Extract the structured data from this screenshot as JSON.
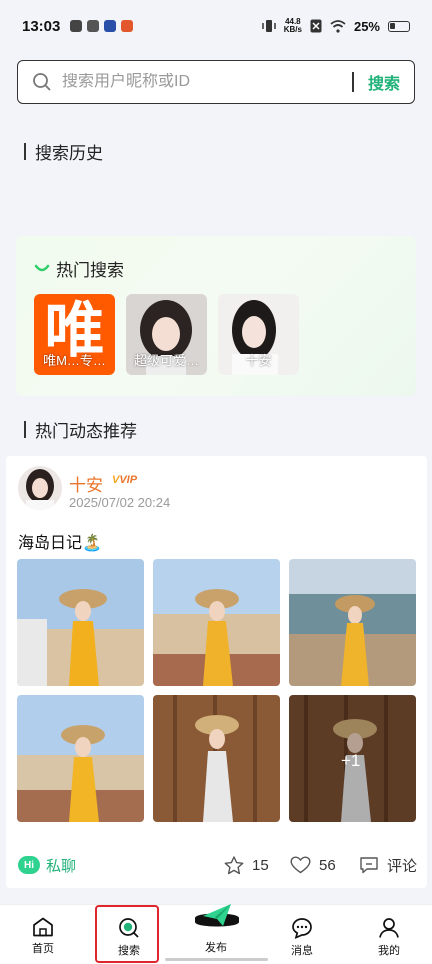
{
  "status_bar": {
    "time": "13:03",
    "net_speed_value": "44.8",
    "net_speed_unit": "KB/s",
    "battery": "25%"
  },
  "search": {
    "placeholder": "搜索用户昵称或ID",
    "button": "搜索"
  },
  "history": {
    "title": "搜索历史"
  },
  "hot_search": {
    "title": "热门搜索",
    "items": [
      {
        "label": "唯M…专…",
        "logo_text": "唯"
      },
      {
        "label": "超级可爱…"
      },
      {
        "label": "十安"
      }
    ]
  },
  "recommend": {
    "title": "热门动态推荐"
  },
  "post": {
    "username": "十安",
    "vip": "VIP",
    "time": "2025/07/02 20:24",
    "text": "海岛日记🏝️",
    "more_photos": "+1",
    "chat_badge": "Hi",
    "chat_label": "私聊",
    "stars": "15",
    "likes": "56",
    "comment_label": "评论"
  },
  "nav": {
    "home": "首页",
    "search": "搜索",
    "publish": "发布",
    "messages": "消息",
    "mine": "我的"
  },
  "colors": {
    "accent_green": "#23b37a",
    "username_orange": "#e9762a",
    "highlight_red": "#e0262d"
  }
}
